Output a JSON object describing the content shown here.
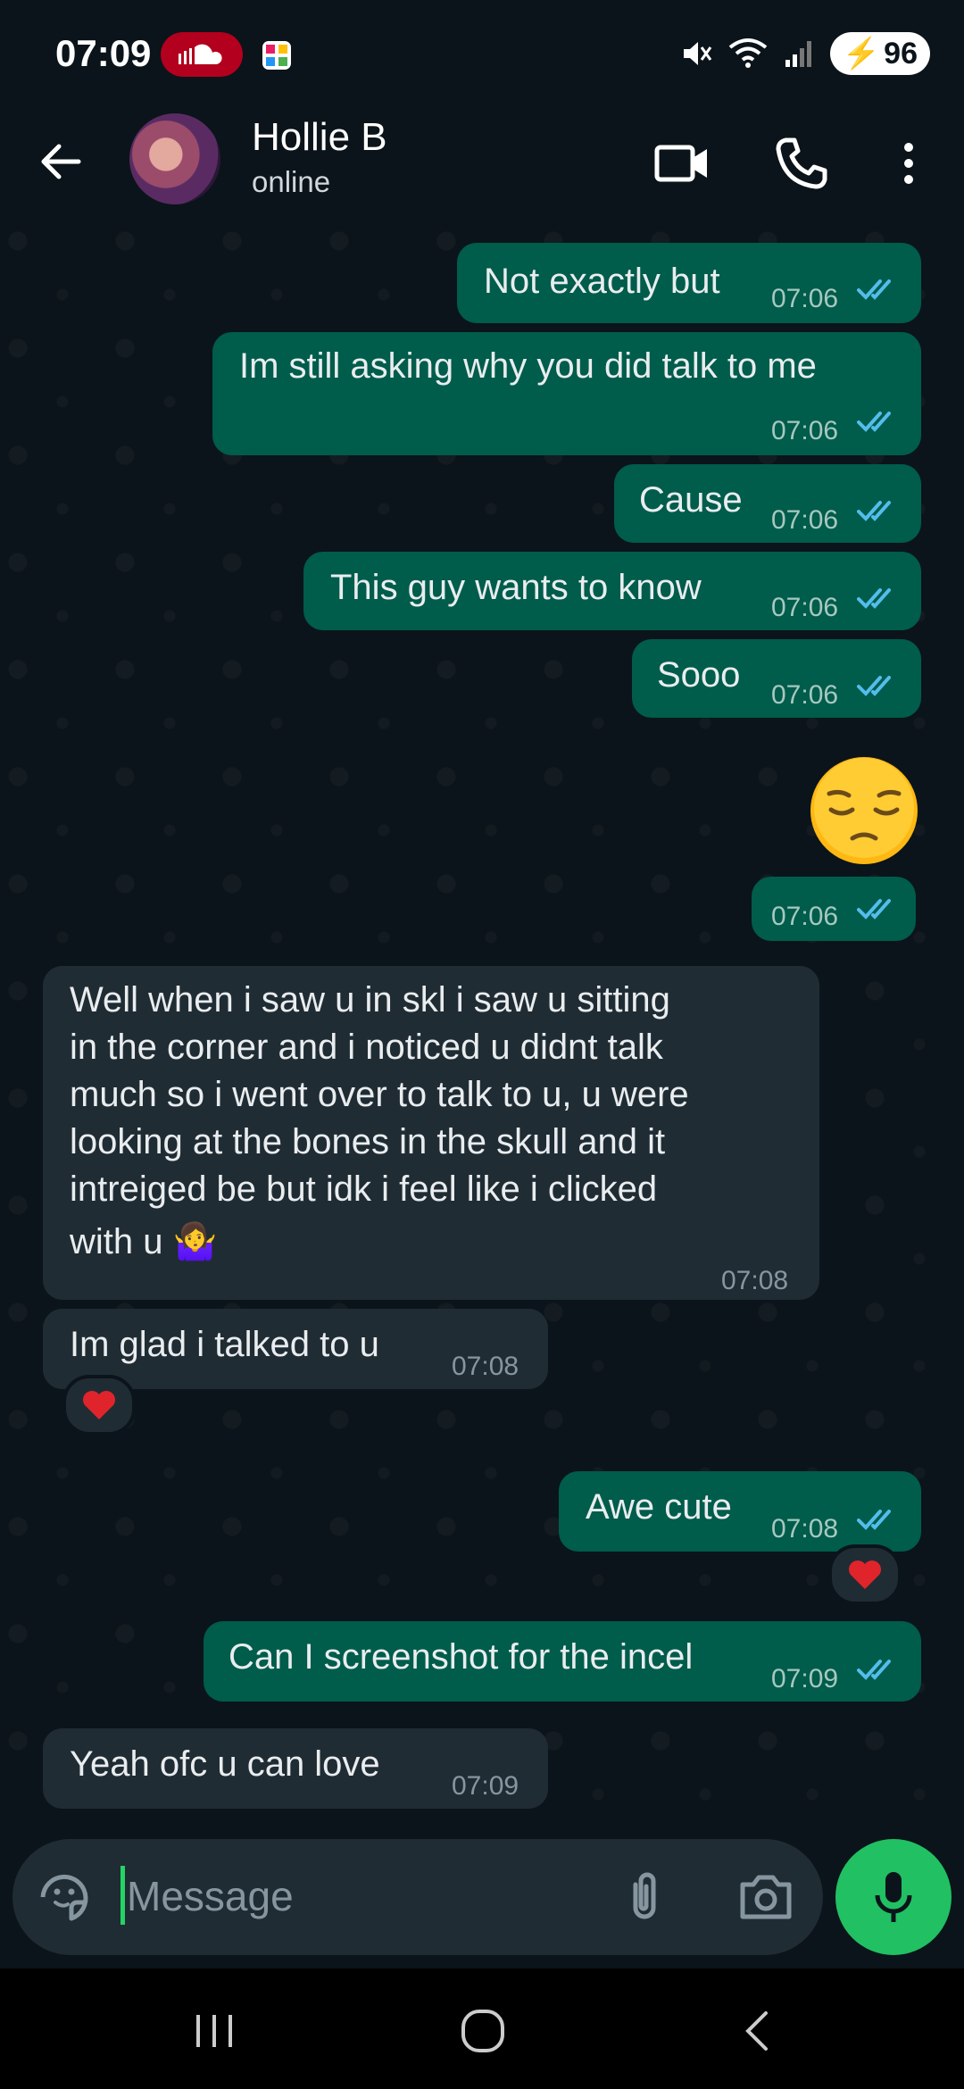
{
  "status_bar": {
    "time": "07:09",
    "battery": "96"
  },
  "header": {
    "contact_name": "Hollie B",
    "contact_status": "online"
  },
  "messages": [
    {
      "dir": "out",
      "text": "Not exactly but",
      "time": "07:06",
      "read": true
    },
    {
      "dir": "out",
      "text": "Im still asking why you did talk to me",
      "time": "07:06",
      "read": true
    },
    {
      "dir": "out",
      "text": "Cause",
      "time": "07:06",
      "read": true
    },
    {
      "dir": "out",
      "text": "This guy wants to know",
      "time": "07:06",
      "read": true
    },
    {
      "dir": "out",
      "text": "Sooo",
      "time": "07:06",
      "read": true
    },
    {
      "dir": "out",
      "text": "😔",
      "time": "07:06",
      "read": true
    },
    {
      "dir": "in",
      "lines": [
        "Well when i saw u in skl i saw u sitting",
        "in the corner and i noticed u didnt talk",
        "much so i went over to talk to u, u were",
        "looking at the bones in the skull and it",
        "intreiged be but idk i feel like i clicked",
        "with u 🤷‍♀️"
      ],
      "time": "07:08"
    },
    {
      "dir": "in",
      "text": "Im glad i talked to u",
      "time": "07:08",
      "reaction": "❤️"
    },
    {
      "dir": "out",
      "text": "Awe cute",
      "time": "07:08",
      "read": true,
      "reaction": "❤️"
    },
    {
      "dir": "out",
      "text": "Can I screenshot for the incel",
      "time": "07:09",
      "read": true
    },
    {
      "dir": "in",
      "text": "Yeah ofc u can love",
      "time": "07:09"
    }
  ],
  "composer": {
    "placeholder": "Message"
  },
  "icons": {
    "back": "back-arrow-icon",
    "video": "video-call-icon",
    "call": "phone-icon",
    "menu": "more-vert-icon",
    "sticker": "sticker-icon",
    "attach": "paperclip-icon",
    "camera": "camera-icon",
    "mic": "mic-icon"
  },
  "colors": {
    "outgoing": "#005c4b",
    "incoming": "#202c33",
    "accent": "#21c063",
    "read_tick": "#53bdeb"
  }
}
